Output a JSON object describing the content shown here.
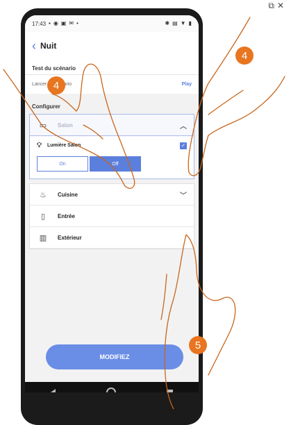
{
  "status": {
    "time": "17:43",
    "left_icons": [
      "photo-icon",
      "location-icon",
      "media-icon",
      "mail-icon"
    ],
    "right_icons": [
      "bluetooth-icon",
      "vibrate-icon",
      "wifi-icon",
      "battery-icon"
    ]
  },
  "header": {
    "title": "Nuit"
  },
  "test": {
    "label": "Test du scénario",
    "launch_label": "Lancer le scénario",
    "play_label": "Play"
  },
  "section_label": "Configurer",
  "rooms": [
    {
      "name": "Salon",
      "icon": "sofa-icon",
      "expanded": true
    },
    {
      "name": "Cuisine",
      "icon": "cooking-pot-icon",
      "expanded": false
    },
    {
      "name": "Entrée",
      "icon": "door-icon",
      "expanded": false
    },
    {
      "name": "Extérieur",
      "icon": "fence-icon",
      "expanded": false
    }
  ],
  "device": {
    "name": "Lumière Salon",
    "icon": "bulb-icon",
    "checked": true,
    "on_label": "On",
    "off_label": "Off",
    "selected": "Off"
  },
  "modify_label": "MODIFIEZ",
  "badges": [
    "4",
    "4",
    "5"
  ],
  "colors": {
    "accent": "#5b7fdc",
    "badge": "#e87520",
    "hand_outline": "#c8651b"
  }
}
